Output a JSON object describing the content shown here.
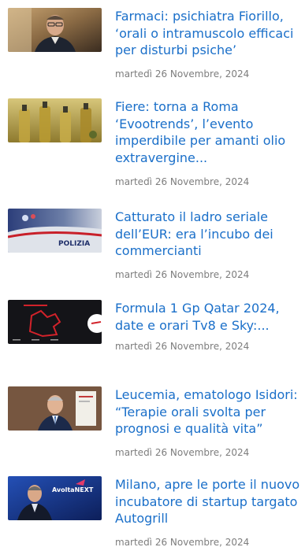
{
  "articles": [
    {
      "title": "Farmaci: psichiatra Fiorillo,\n‘orali o intramuscolo efficaci\nper disturbi psiche’",
      "date": "martedì 26 Novembre, 2024",
      "thumb_icon": "portrait-man-glasses-thumbnail"
    },
    {
      "title": "Fiere: torna a Roma\n‘Evootrends’, l’evento\nimperdibile per amanti olio\nextravergine...",
      "date": "martedì 26 Novembre, 2024",
      "thumb_icon": "olive-oil-bottles-thumbnail"
    },
    {
      "title": "Catturato il ladro seriale\ndell’EUR: era l’incubo dei\ncommercianti",
      "date": "martedì 26 Novembre, 2024",
      "thumb_icon": "police-car-thumbnail"
    },
    {
      "title": "Formula 1 Gp Qatar 2024,\ndate e orari Tv8 e Sky:...",
      "date": "martedì 26 Novembre, 2024",
      "thumb_icon": "race-track-map-thumbnail"
    },
    {
      "title": "Leucemia, ematologo Isidori:\n“Terapie orali svolta per\nprognosi e qualità vita”",
      "date": "martedì 26 Novembre, 2024",
      "thumb_icon": "portrait-man-suit-thumbnail"
    },
    {
      "title": "Milano, apre le porte il nuovo\nincubatore di startup targato\nAutogrill",
      "date": "martedì 26 Novembre, 2024",
      "thumb_icon": "presenter-stage-thumbnail",
      "thumb_text": "AvoltaNEXT"
    }
  ]
}
